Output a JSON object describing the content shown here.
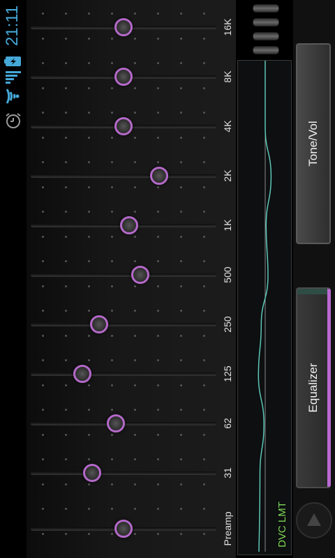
{
  "status_bar": {
    "time": "21:11",
    "icons": [
      "alarm-icon",
      "wifi-icon",
      "signal-icon",
      "battery-charging-icon"
    ]
  },
  "equalizer": {
    "bands": [
      {
        "label": "16K",
        "level": 0.5
      },
      {
        "label": "8K",
        "level": 0.5
      },
      {
        "label": "4K",
        "level": 0.5
      },
      {
        "label": "2K",
        "level": 0.69
      },
      {
        "label": "1K",
        "level": 0.53
      },
      {
        "label": "500",
        "level": 0.59
      },
      {
        "label": "250",
        "level": 0.37
      },
      {
        "label": "125",
        "level": 0.28
      },
      {
        "label": "62",
        "level": 0.46
      },
      {
        "label": "31",
        "level": 0.33
      },
      {
        "label": "Preamp",
        "level": 0.5
      }
    ],
    "graph_label": "DVC LMT",
    "curve_color": "#5ec9b8",
    "knob_color": "#b469c9"
  },
  "tabs": [
    {
      "label": "Tone/Vol",
      "active": false
    },
    {
      "label": "Equalizer",
      "active": true
    }
  ]
}
